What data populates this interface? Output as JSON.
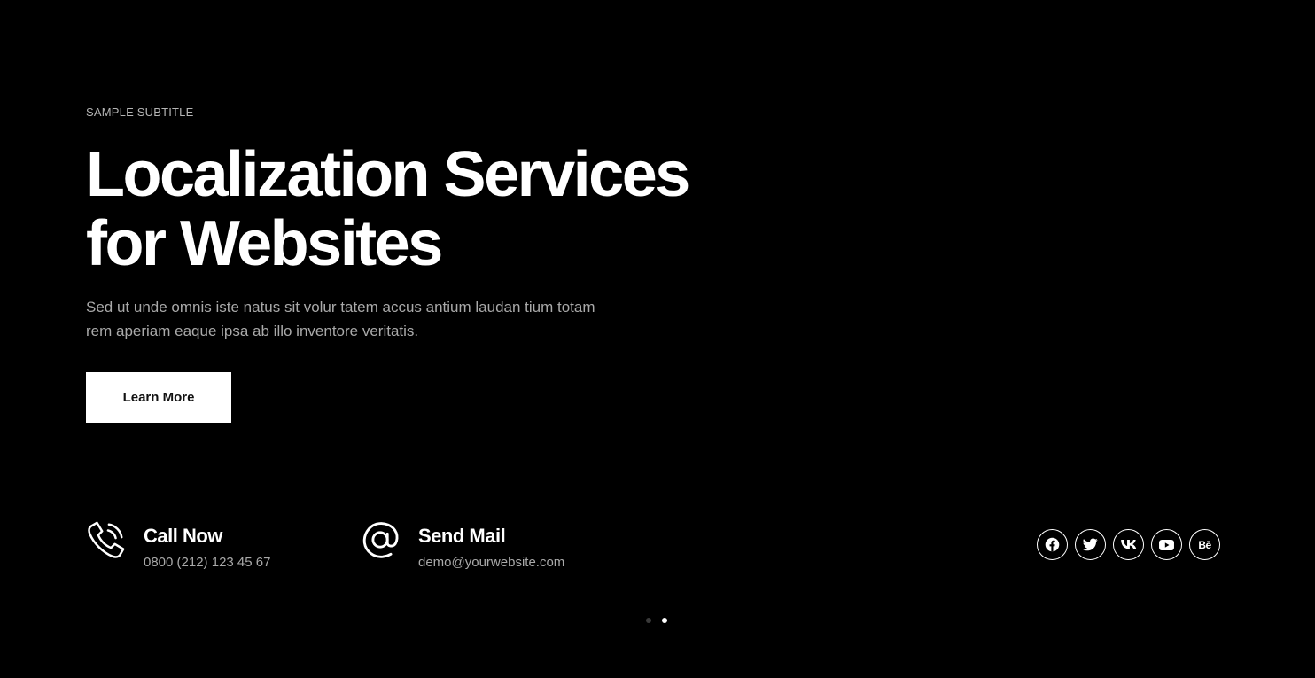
{
  "hero": {
    "subtitle": "SAMPLE SUBTITLE",
    "title_lines": [
      "Localization Services",
      "for Websites"
    ],
    "description_lines": [
      "Sed ut unde omnis iste natus sit volur tatem accus antium laudan tium totam",
      "rem aperiam eaque ipsa ab illo inventore veritatis."
    ],
    "cta_label": "Learn More"
  },
  "contacts": [
    {
      "icon": "phone-icon",
      "heading": "Call Now",
      "value": "0800 (212) 123 45 67"
    },
    {
      "icon": "at-sign-icon",
      "heading": "Send Mail",
      "value": "demo@yourwebsite.com"
    }
  ],
  "social": {
    "icons": [
      "facebook-icon",
      "twitter-icon",
      "vk-icon",
      "youtube-icon",
      "behance-icon"
    ],
    "behance_text": "Bē"
  },
  "slider": {
    "slide_count": 2,
    "active_index": 1
  },
  "colors": {
    "background": "#000000",
    "heading": "#ffffff",
    "muted_text": "#a9a9a9",
    "button_bg": "#ffffff",
    "button_text": "#111111",
    "inactive_dot": "#3a3a3a"
  }
}
